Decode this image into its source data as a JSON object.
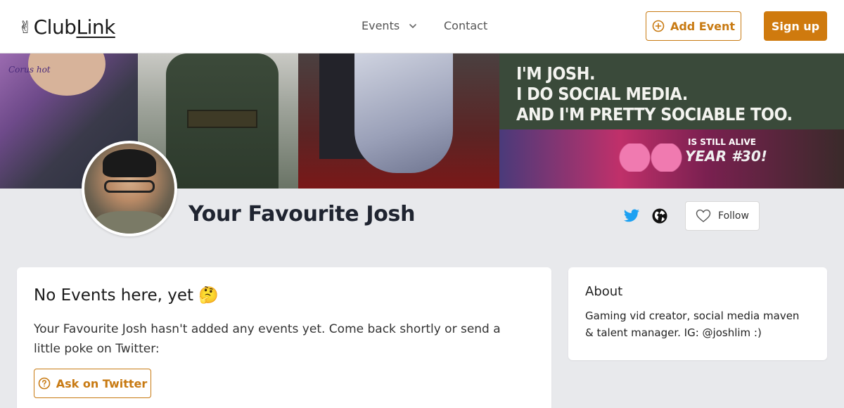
{
  "header": {
    "logo_text_main": "Club",
    "logo_text_link": "Link",
    "logo_icon": "victory-hand-icon",
    "nav": [
      {
        "label": "Events",
        "icon": "chevron-down-icon"
      },
      {
        "label": "Contact"
      }
    ],
    "add_event_label": "Add Event",
    "add_event_icon": "plus-circle-icon",
    "signup_label": "Sign up"
  },
  "banner": {
    "panel1_tag": "Corus hot",
    "headline_lines": [
      "I'M JOSH.",
      "I DO SOCIAL MEDIA.",
      "AND I'M PRETTY SOCIABLE TOO."
    ],
    "subline": "IS STILL ALIVE",
    "year_text": "YEAR #30!"
  },
  "profile": {
    "name": "Your Favourite Josh",
    "icons": [
      "twitter-icon",
      "globe-icon"
    ],
    "follow_label": "Follow",
    "follow_icon": "heart-icon"
  },
  "events_card": {
    "title": "No Events here, yet 🤔",
    "description": "Your Favourite Josh hasn't added any events yet. Come back shortly or send a little poke on Twitter:",
    "ask_label": "Ask on Twitter",
    "ask_icon": "help-circle-icon"
  },
  "about_card": {
    "title": "About",
    "text": "Gaming vid creator, social media maven & talent manager. IG: @joshlim :)"
  },
  "colors": {
    "accent": "#cf7a0e",
    "twitter": "#1da1f2",
    "background": "#e8e9ec"
  }
}
